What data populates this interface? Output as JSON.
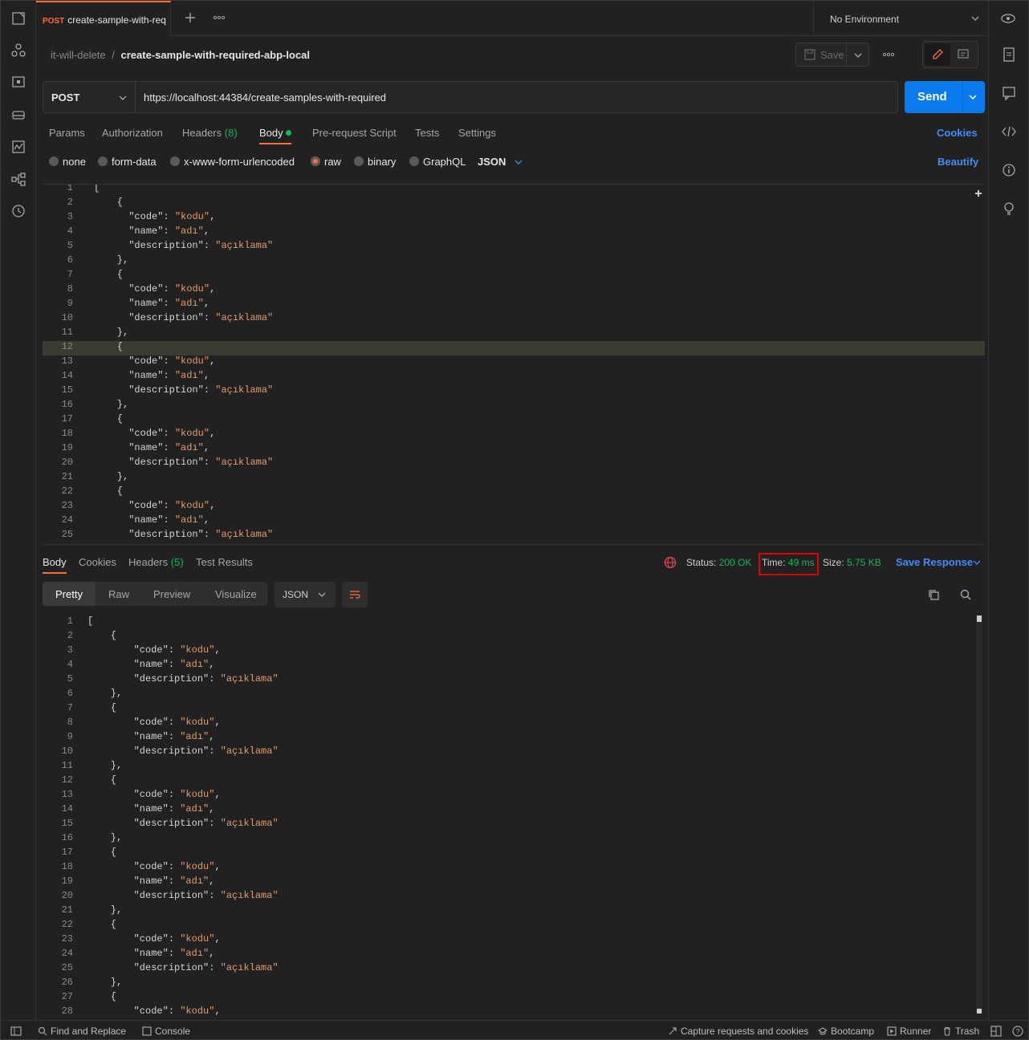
{
  "tab": {
    "method": "POST",
    "title": "create-sample-with-req"
  },
  "environment": {
    "label": "No Environment"
  },
  "breadcrumb": {
    "parent": "it-will-delete",
    "separator": "/",
    "current": "create-sample-with-required-abp-local"
  },
  "toolbar": {
    "save_label": "Save"
  },
  "request": {
    "method": "POST",
    "url": "https://localhost:44384/create-samples-with-required",
    "send_label": "Send"
  },
  "request_tabs": {
    "params": "Params",
    "authorization": "Authorization",
    "headers": "Headers",
    "headers_count": "(8)",
    "body": "Body",
    "prerequest": "Pre-request Script",
    "tests": "Tests",
    "settings": "Settings",
    "cookies": "Cookies"
  },
  "body_types": {
    "none": "none",
    "form_data": "form-data",
    "urlencoded": "x-www-form-urlencoded",
    "raw": "raw",
    "binary": "binary",
    "graphql": "GraphQL",
    "format": "JSON",
    "beautify": "Beautify"
  },
  "request_body_lines": [
    "[",
    "    {",
    "      \"code\": \"kodu\",",
    "      \"name\": \"adı\",",
    "      \"description\": \"açıklama\"",
    "    },",
    "    {",
    "      \"code\": \"kodu\",",
    "      \"name\": \"adı\",",
    "      \"description\": \"açıklama\"",
    "    },",
    "    {",
    "      \"code\": \"kodu\",",
    "      \"name\": \"adı\",",
    "      \"description\": \"açıklama\"",
    "    },",
    "    {",
    "      \"code\": \"kodu\",",
    "      \"name\": \"adı\",",
    "      \"description\": \"açıklama\"",
    "    },",
    "    {",
    "      \"code\": \"kodu\",",
    "      \"name\": \"adı\",",
    "      \"description\": \"açıklama\""
  ],
  "response_tabs": {
    "body": "Body",
    "cookies": "Cookies",
    "headers": "Headers",
    "headers_count": "(5)",
    "test_results": "Test Results"
  },
  "response_meta": {
    "status_label": "Status:",
    "status_value": "200 OK",
    "time_label": "Time:",
    "time_value": "49 ms",
    "size_label": "Size:",
    "size_value": "5.75 KB",
    "save_response": "Save Response"
  },
  "view_modes": {
    "pretty": "Pretty",
    "raw": "Raw",
    "preview": "Preview",
    "visualize": "Visualize",
    "format": "JSON"
  },
  "response_body_lines": [
    "[",
    "    {",
    "        \"code\": \"kodu\",",
    "        \"name\": \"adı\",",
    "        \"description\": \"açıklama\"",
    "    },",
    "    {",
    "        \"code\": \"kodu\",",
    "        \"name\": \"adı\",",
    "        \"description\": \"açıklama\"",
    "    },",
    "    {",
    "        \"code\": \"kodu\",",
    "        \"name\": \"adı\",",
    "        \"description\": \"açıklama\"",
    "    },",
    "    {",
    "        \"code\": \"kodu\",",
    "        \"name\": \"adı\",",
    "        \"description\": \"açıklama\"",
    "    },",
    "    {",
    "        \"code\": \"kodu\",",
    "        \"name\": \"adı\",",
    "        \"description\": \"açıklama\"",
    "    },",
    "    {",
    "        \"code\": \"kodu\","
  ],
  "footer": {
    "find_replace": "Find and Replace",
    "console": "Console",
    "capture": "Capture requests and cookies",
    "bootcamp": "Bootcamp",
    "runner": "Runner",
    "trash": "Trash"
  },
  "colors": {
    "accent": "#ff6c37",
    "send": "#097bed",
    "success": "#0cbb52",
    "link": "#3f8ef5",
    "highlight_box": "#e00000"
  }
}
